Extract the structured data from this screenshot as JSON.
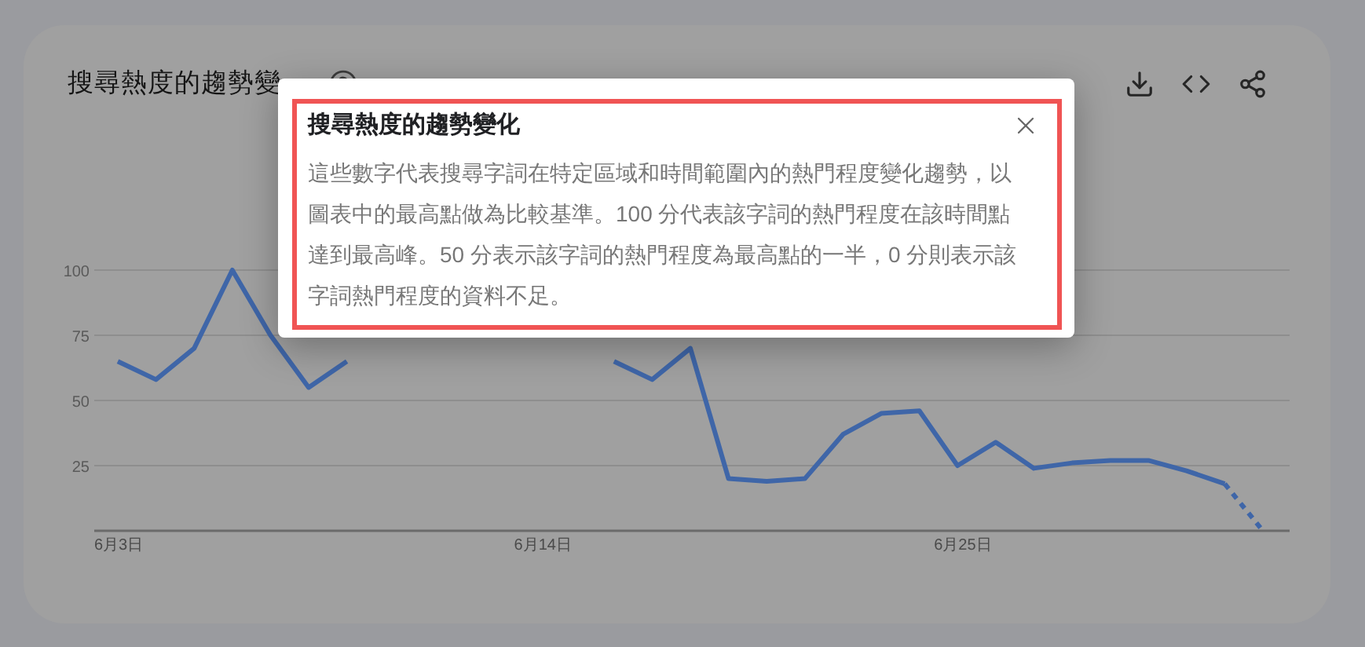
{
  "card": {
    "title": "搜尋熱度的趨勢變",
    "chart_data": {
      "type": "line",
      "grid": true,
      "ylim": [
        0,
        100
      ],
      "yticks": [
        25,
        50,
        75,
        100
      ],
      "categories": [
        "6月3日",
        null,
        null,
        null,
        null,
        null,
        null,
        null,
        null,
        null,
        null,
        "6月14日",
        null,
        null,
        null,
        null,
        null,
        null,
        null,
        null,
        null,
        null,
        "6月25日",
        null,
        null,
        null,
        null,
        null,
        null,
        null,
        null
      ],
      "series": [
        {
          "color": "#3f66a8",
          "line_style": "solid",
          "values": [
            65,
            58,
            70,
            100,
            75,
            55,
            65,
            null,
            null,
            null,
            null,
            null,
            null,
            65,
            58,
            70,
            20,
            19,
            20,
            37,
            45,
            46,
            25,
            34,
            24,
            26,
            27,
            27,
            23,
            18,
            null
          ]
        },
        {
          "color": "#3f66a8",
          "line_style": "dashed",
          "values": [
            null,
            null,
            null,
            null,
            null,
            null,
            null,
            null,
            null,
            null,
            null,
            null,
            null,
            null,
            null,
            null,
            null,
            null,
            null,
            null,
            null,
            null,
            null,
            null,
            null,
            null,
            null,
            null,
            null,
            18,
            0
          ]
        }
      ]
    }
  },
  "dialog": {
    "title": "搜尋熱度的趨勢變化",
    "body": "這些數字代表搜尋字詞在特定區域和時間範圍內的熱門程度變化趨勢，以圖表中的最高點做為比較基準。100 分代表該字詞的熱門程度在該時間點達到最高峰。50 分表示該字詞的熱門程度為最高點的一半，0 分則表示該字詞熱門程度的資料不足。"
  }
}
